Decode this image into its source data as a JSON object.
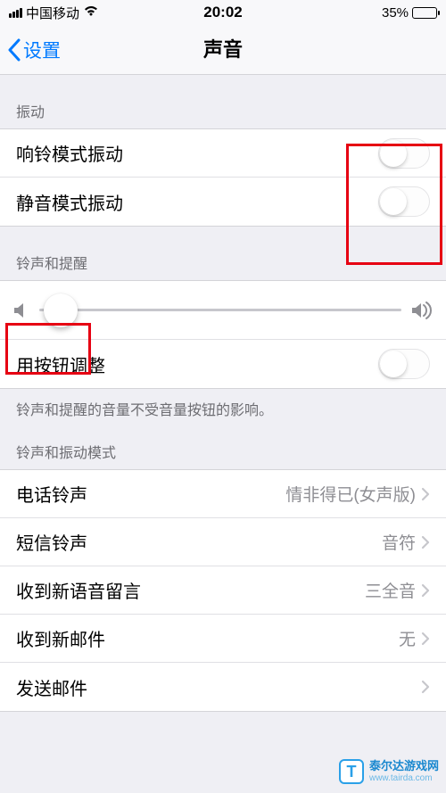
{
  "status_bar": {
    "carrier": "中国移动",
    "time": "20:02",
    "battery_pct": "35%"
  },
  "nav": {
    "back_label": "设置",
    "title": "声音"
  },
  "sections": {
    "vibration_header": "振动",
    "vibrate_ring_label": "响铃模式振动",
    "vibrate_silent_label": "静音模式振动",
    "ringer_header": "铃声和提醒",
    "change_with_buttons_label": "用按钮调整",
    "ringer_note": "铃声和提醒的音量不受音量按钮的影响。",
    "pattern_header": "铃声和振动模式",
    "ringtone": {
      "label": "电话铃声",
      "value": "情非得已(女声版)"
    },
    "text_tone": {
      "label": "短信铃声",
      "value": "音符"
    },
    "voicemail": {
      "label": "收到新语音留言",
      "value": "三全音"
    },
    "new_mail": {
      "label": "收到新邮件",
      "value": "无"
    },
    "sent_mail": {
      "label": "发送邮件",
      "value": ""
    }
  },
  "toggles": {
    "vibrate_ring": false,
    "vibrate_silent": false,
    "change_with_buttons": false
  },
  "slider": {
    "volume_pct": 6
  },
  "watermark": {
    "logo_char": "T",
    "name": "泰尔达游戏网",
    "url": "www.tairda.com"
  }
}
